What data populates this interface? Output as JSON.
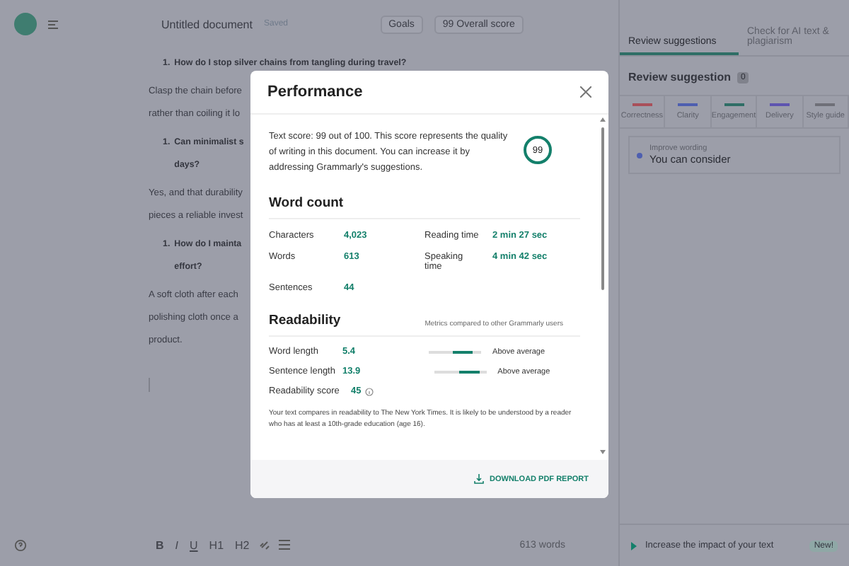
{
  "header": {
    "document_title": "Untitled document",
    "status": "Saved",
    "goals": "Goals",
    "overall_score": "99",
    "overall_label": "Overall score"
  },
  "document": [
    {
      "kind": "heading",
      "number": "1.",
      "lines": [
        "How do I stop silver chains from tangling during travel?"
      ]
    },
    {
      "kind": "paragraph",
      "lines": [
        "Clasp the chain before",
        "rather than coiling it lo"
      ]
    },
    {
      "kind": "heading",
      "number": "1.",
      "lines": [
        "Can minimalist s",
        "days?"
      ]
    },
    {
      "kind": "paragraph",
      "lines": [
        "Yes, and that durability",
        "pieces a reliable invest"
      ]
    },
    {
      "kind": "heading",
      "number": "1.",
      "lines": [
        "How do I mainta",
        "effort?"
      ]
    },
    {
      "kind": "paragraph",
      "lines": [
        "A soft cloth after each",
        "polishing cloth once a",
        "product."
      ]
    }
  ],
  "toolbar": {
    "format_buttons": [
      "B",
      "I",
      "U",
      "H1",
      "H2"
    ],
    "word_count": "613 words"
  },
  "sidebar": {
    "tabs": [
      {
        "label": "Review suggestions",
        "selected": true
      },
      {
        "label": "Check for AI text & plagiarism",
        "selected": false
      }
    ],
    "heading": "Review suggestion",
    "count": "0",
    "categories": [
      {
        "label": "Correctness",
        "color": "#a9505a"
      },
      {
        "label": "Clarity",
        "color": "#4e5fb0"
      },
      {
        "label": "Engagement",
        "color": "#2f6e66"
      },
      {
        "label": "Delivery",
        "color": "#5e54b0"
      },
      {
        "label": "Style guide",
        "color": "#6f7078"
      }
    ],
    "suggestion": {
      "type": "Improve wording",
      "text": "You can consider"
    },
    "promo": {
      "text": "Increase the impact of your text",
      "badge": "New!"
    }
  },
  "modal": {
    "title": "Performance",
    "score_text": "Text score: 99 out of 100. This score represents the quality of writing in this document. You can increase it by addressing Grammarly's suggestions.",
    "score": "99",
    "word_count": {
      "heading": "Word count",
      "stats": [
        {
          "label": "Characters",
          "value": "4,023"
        },
        {
          "label": "Reading time",
          "value": "2 min 27 sec"
        },
        {
          "label": "Words",
          "value": "613"
        },
        {
          "label": "Speaking time",
          "value": "4 min 42 sec"
        },
        {
          "label": "Sentences",
          "value": "44"
        }
      ]
    },
    "readability": {
      "heading": "Readability",
      "note": "Metrics compared to other Grammarly users",
      "metrics": [
        {
          "label": "Word length",
          "value": "5.4",
          "level": 0.85,
          "rating": "Above average"
        },
        {
          "label": "Sentence length",
          "value": "13.9",
          "level": 0.88,
          "rating": "Above average"
        }
      ],
      "score_label": "Readability score",
      "score_value": "45",
      "summary": "Your text compares in readability to The New York Times. It is likely to be understood by a reader who has at least a 10th-grade education (age 16)."
    },
    "download": "DOWNLOAD PDF REPORT"
  }
}
